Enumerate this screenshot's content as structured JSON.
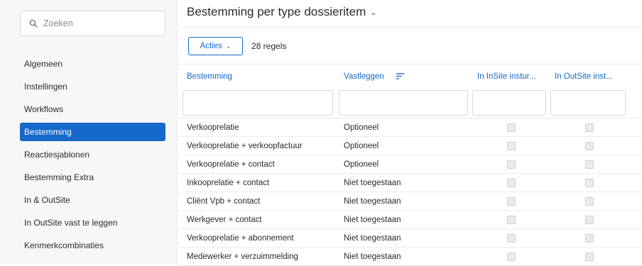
{
  "search": {
    "placeholder": "Zoeken",
    "icon": "search-icon"
  },
  "sidebar": {
    "items": [
      {
        "label": "Algemeen",
        "active": false
      },
      {
        "label": "Instellingen",
        "active": false
      },
      {
        "label": "Workflows",
        "active": false
      },
      {
        "label": "Bestemming",
        "active": true
      },
      {
        "label": "Reactiesjablonen",
        "active": false
      },
      {
        "label": "Bestemming Extra",
        "active": false
      },
      {
        "label": "In & OutSite",
        "active": false
      },
      {
        "label": "In OutSite vast te leggen",
        "active": false
      },
      {
        "label": "Kenmerkcombinaties",
        "active": false
      }
    ]
  },
  "page": {
    "title": "Bestemming per type dossieritem"
  },
  "toolbar": {
    "actions_label": "Acties",
    "count_text": "28 regels"
  },
  "table": {
    "columns": [
      {
        "label": "Bestemming"
      },
      {
        "label": "Vastleggen"
      },
      {
        "label": "In InSite instur..."
      },
      {
        "label": "In OutSite inst..."
      }
    ],
    "rows": [
      {
        "bestemming": "Verkooprelatie",
        "vastleggen": "Optioneel",
        "insite": false,
        "outsite": false
      },
      {
        "bestemming": "Verkooprelatie + verkoopfactuur",
        "vastleggen": "Optioneel",
        "insite": false,
        "outsite": false
      },
      {
        "bestemming": "Verkooprelatie + contact",
        "vastleggen": "Optioneel",
        "insite": false,
        "outsite": false
      },
      {
        "bestemming": "Inkooprelatie + contact",
        "vastleggen": "Niet toegestaan",
        "insite": false,
        "outsite": false
      },
      {
        "bestemming": "Cliënt Vpb + contact",
        "vastleggen": "Niet toegestaan",
        "insite": false,
        "outsite": false
      },
      {
        "bestemming": "Werkgever + contact",
        "vastleggen": "Niet toegestaan",
        "insite": false,
        "outsite": false
      },
      {
        "bestemming": "Verkooprelatie + abonnement",
        "vastleggen": "Niet toegestaan",
        "insite": false,
        "outsite": false
      },
      {
        "bestemming": "Medewerker + verzuimmelding",
        "vastleggen": "Niet toegestaan",
        "insite": false,
        "outsite": false
      }
    ]
  },
  "colors": {
    "accent": "#1668c9",
    "sidebar_bg": "#f7f7f8",
    "active_text": "#ffffff"
  }
}
